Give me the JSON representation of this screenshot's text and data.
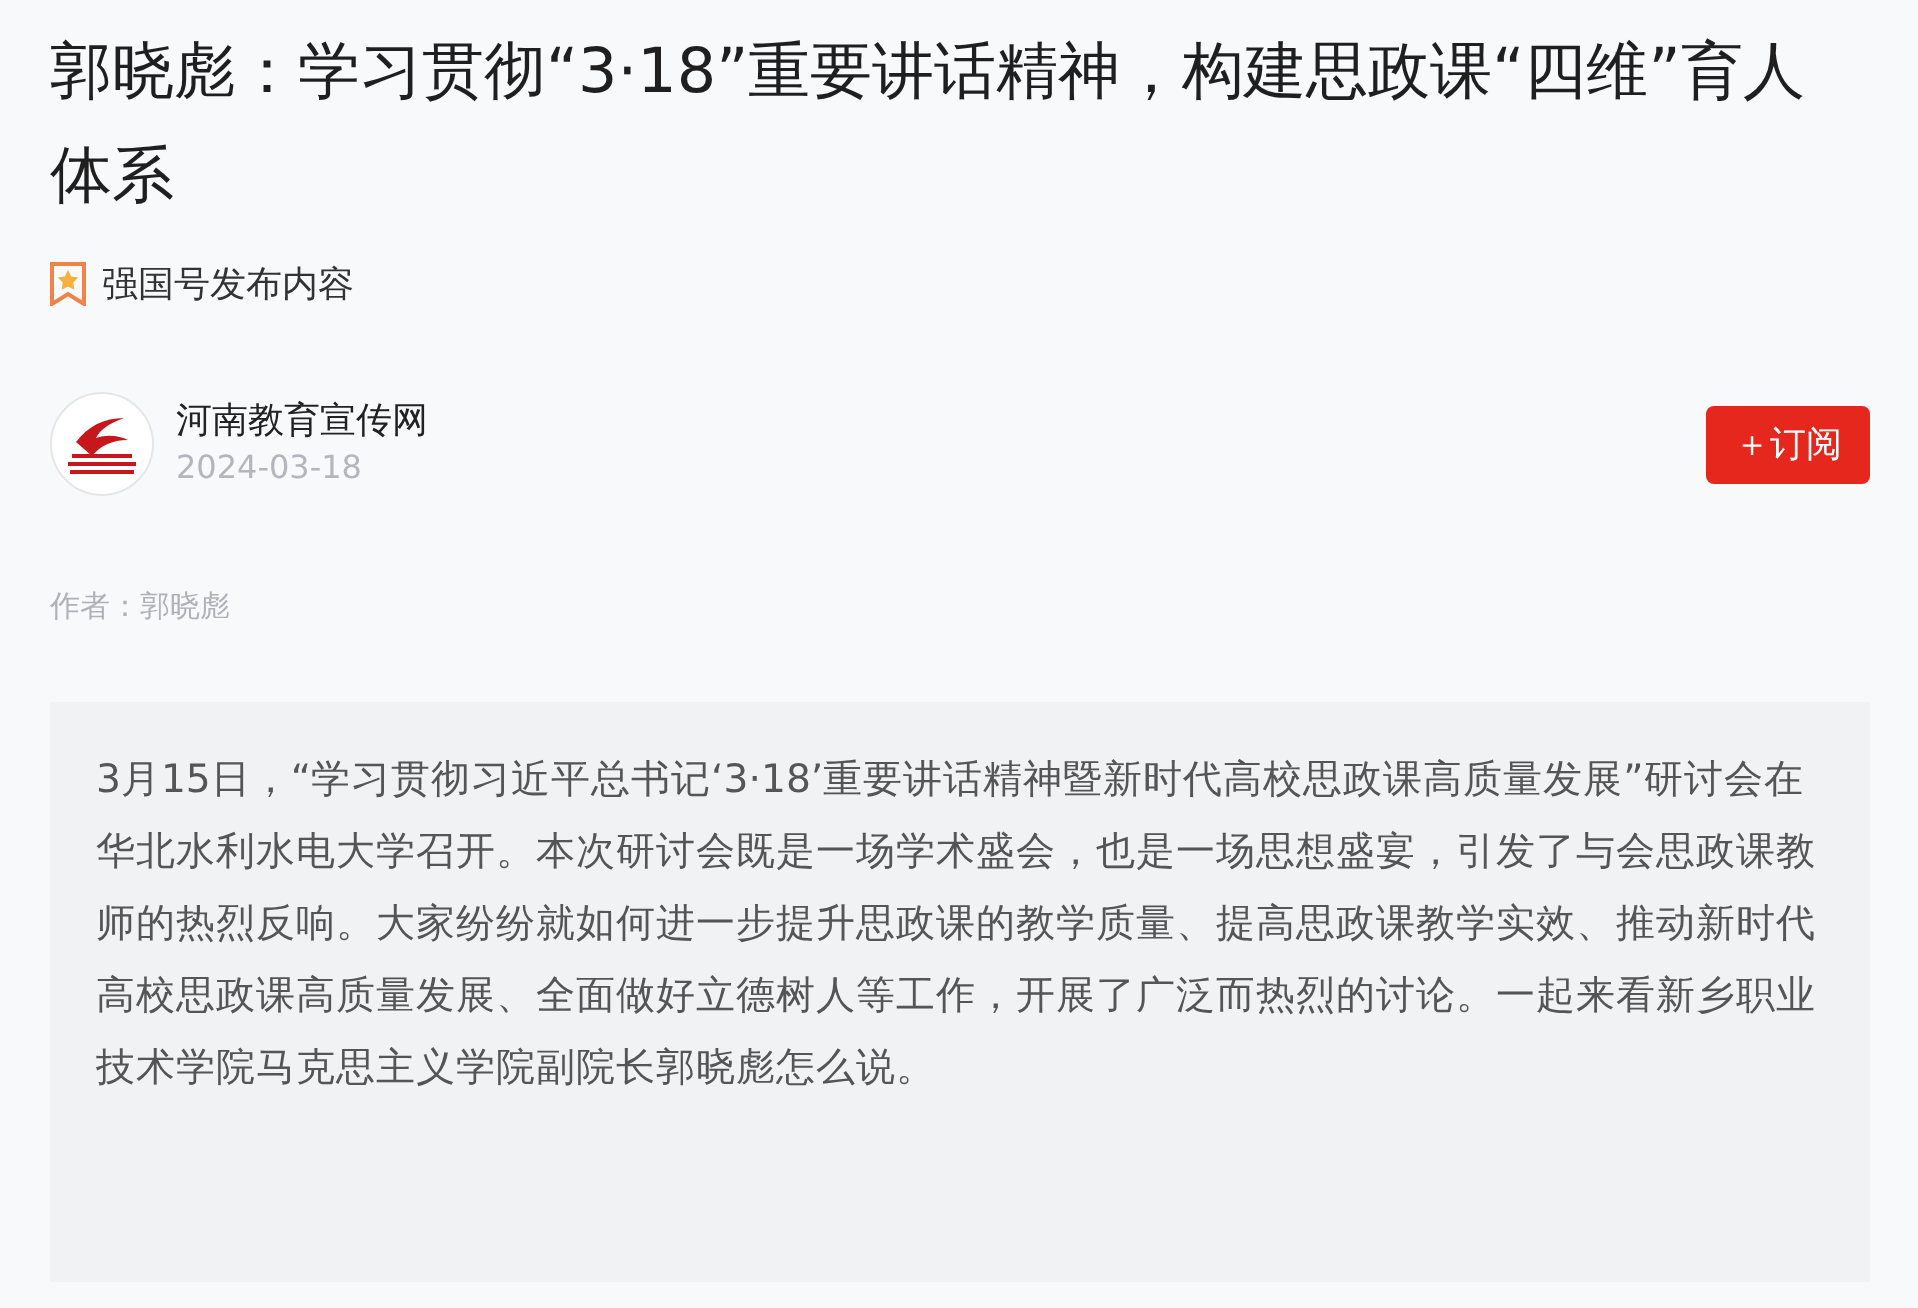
{
  "article": {
    "title": "郭晓彪：学习贯彻“3·18”重要讲话精神，构建思政课“四维”育人体系",
    "source_tag": "强国号发布内容",
    "publisher": {
      "name": "河南教育宣传网",
      "date": "2024-03-18"
    },
    "subscribe_button": "＋订阅",
    "author": "作者：郭晓彪",
    "summary": "3月15日，“学习贯彻习近平总书记‘3·18’重要讲话精神暨新时代高校思政课高质量发展”研讨会在华北水利水电大学召开。本次研讨会既是一场学术盛会，也是一场思想盛宴，引发了与会思政课教师的热烈反响。大家纷纷就如何进一步提升思政课的教学质量、提高思政课教学实效、推动新时代高校思政课高质量发展、全面做好立德树人等工作，开展了广泛而热烈的讨论。一起来看新乡职业技术学院马克思主义学院副院长郭晓彪怎么说。"
  }
}
